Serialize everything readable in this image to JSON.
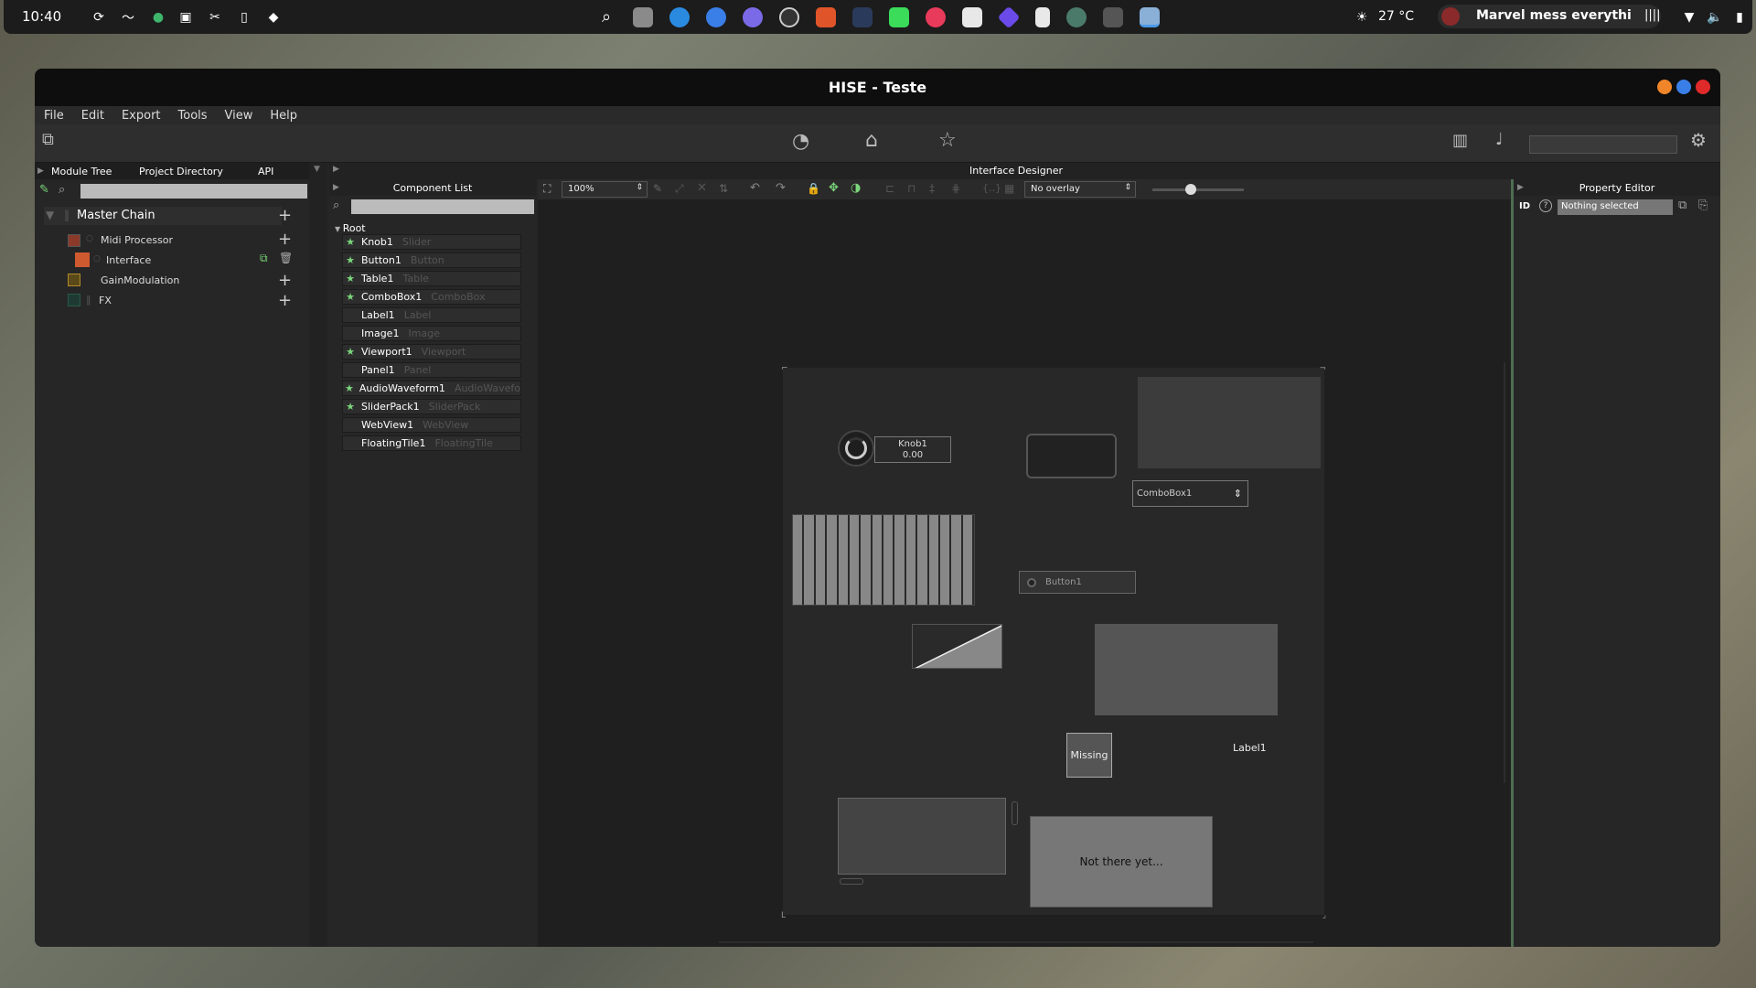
{
  "system": {
    "time": "10:40",
    "weather": "27 °C",
    "media": "Marvel mess everything"
  },
  "window": {
    "title": "HISE - Teste"
  },
  "menu": [
    "File",
    "Edit",
    "Export",
    "Tools",
    "View",
    "Help"
  ],
  "left_panel": {
    "tabs": [
      "Module Tree",
      "Project Directory",
      "API"
    ],
    "root": "Master Chain",
    "modules": [
      {
        "name": "Midi Processor",
        "color": "#8b3a2a"
      },
      {
        "name": "Interface",
        "color": "#d05a30"
      },
      {
        "name": "GainModulation",
        "color": "#b08a2a"
      },
      {
        "name": "FX",
        "color": "#2a5a4a"
      }
    ]
  },
  "component_list": {
    "title": "Component List",
    "root": "Root",
    "items": [
      {
        "name": "Knob1",
        "type": "Slider",
        "starred": true
      },
      {
        "name": "Button1",
        "type": "Button",
        "starred": true
      },
      {
        "name": "Table1",
        "type": "Table",
        "starred": true
      },
      {
        "name": "ComboBox1",
        "type": "ComboBox",
        "starred": true
      },
      {
        "name": "Label1",
        "type": "Label",
        "starred": false
      },
      {
        "name": "Image1",
        "type": "Image",
        "starred": false
      },
      {
        "name": "Viewport1",
        "type": "Viewport",
        "starred": true
      },
      {
        "name": "Panel1",
        "type": "Panel",
        "starred": false
      },
      {
        "name": "AudioWaveform1",
        "type": "AudioWavefo",
        "starred": true
      },
      {
        "name": "SliderPack1",
        "type": "SliderPack",
        "starred": true
      },
      {
        "name": "WebView1",
        "type": "WebView",
        "starred": false
      },
      {
        "name": "FloatingTile1",
        "type": "FloatingTile",
        "starred": false
      }
    ]
  },
  "designer": {
    "title": "Interface Designer",
    "zoom": "100%",
    "overlay": "No overlay",
    "slider_fraction": 0.42,
    "knob_label": "Knob1",
    "knob_value": "0.00",
    "combobox_label": "ComboBox1",
    "button_label": "Button1",
    "image_missing": "Missing",
    "label_text": "Label1",
    "webview_text": "Not there yet...",
    "slider_count": 16
  },
  "property_editor": {
    "title": "Property Editor",
    "id_label": "ID",
    "selection": "Nothing selected"
  }
}
